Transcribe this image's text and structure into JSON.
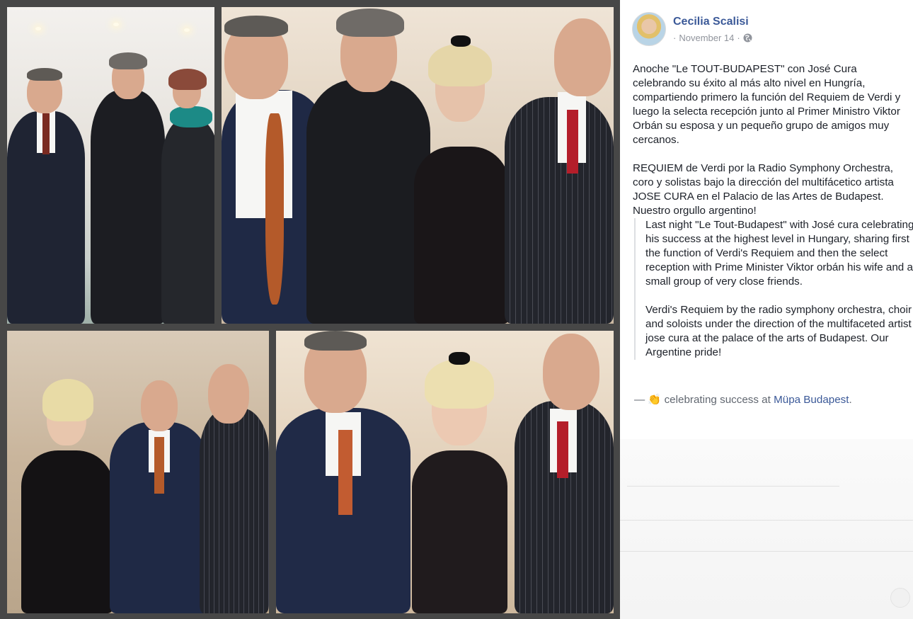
{
  "post": {
    "author": "Cecilia Scalisi",
    "date": "November 14",
    "separator": "·",
    "privacy_icon": "globe-icon",
    "paragraph1": "Anoche \"Le TOUT-BUDAPEST\" con José Cura celebrando su éxito al más alto nivel en Hungría, compartiendo primero la función del Requiem de Verdi y luego la selecta recepción junto al Primer Ministro Viktor Orbán su esposa y un pequeño grupo de amigos muy cercanos.",
    "paragraph2": "REQUIEM de Verdi por la Radio Symphony Orchestra, coro y solistas bajo la dirección del multifácetico artista JOSE CURA en el Palacio de las Artes de Budapest. Nuestro orgullo argentino!",
    "translation1": "Last night \"Le Tout-Budapest\" with José cura celebrating his success at the highest level in Hungary, sharing first the function of Verdi's Requiem and then the select reception with Prime Minister Viktor orbán his wife and a small group of very close friends.",
    "translation2": "Verdi's Requiem by the radio symphony orchestra, choir and soloists under the direction of the multifaceted artist jose cura at the palace of the arts of Budapest. Our Argentine pride!",
    "feeling_prefix": "—",
    "feeling_icon": "clapping-hands-icon",
    "feeling_text": "celebrating success at",
    "feeling_place": "Müpa Budapest",
    "feeling_suffix": "."
  },
  "colors": {
    "link": "#3b5998",
    "text": "#1d2129",
    "meta": "#90949c",
    "background": "#3f3f3f"
  }
}
